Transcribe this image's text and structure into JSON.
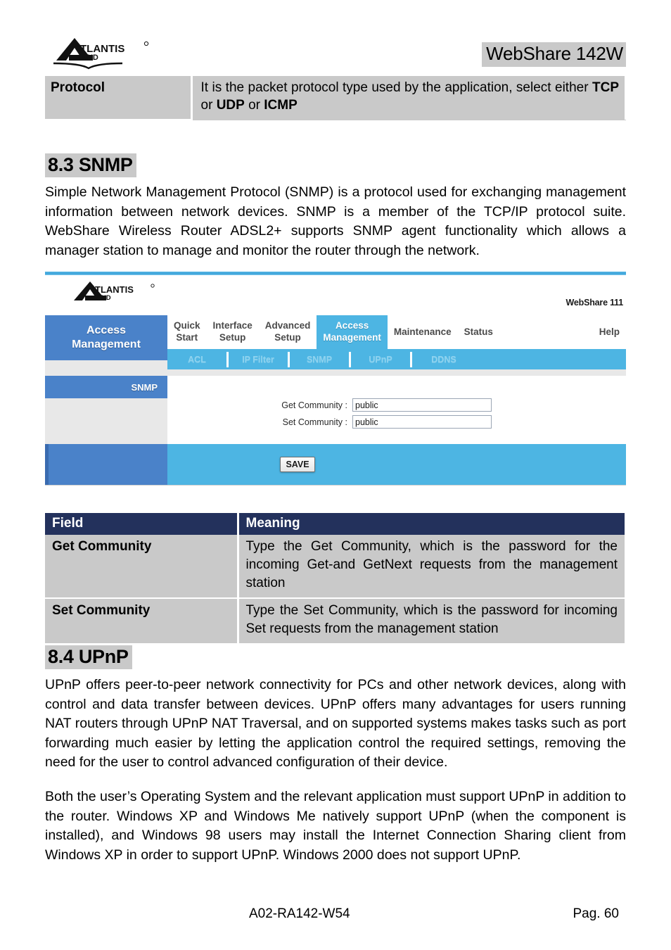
{
  "header": {
    "logo_alt": "ATLANTIS LAND",
    "logo_main": "TLANTIS",
    "logo_sub": "AND",
    "doc_title": "WebShare 142W"
  },
  "protocol_table": {
    "field": "Protocol",
    "meaning_prefix": "It is the packet protocol type used by the application, select either ",
    "meaning_tcp": "TCP",
    "meaning_or1": " or ",
    "meaning_udp": "UDP",
    "meaning_or2": " or ",
    "meaning_icmp": "ICMP"
  },
  "snmp_section": {
    "heading": "8.3 SNMP",
    "paragraph": "Simple Network Management Protocol (SNMP) is a protocol used for exchanging management information between network devices. SNMP is a member of the TCP/IP protocol suite. WebShare Wireless  Router ADSL2+ supports SNMP agent functionality which allows a manager station to manage and monitor the router through the network."
  },
  "router_ui": {
    "logo_main": "TLANTIS",
    "logo_sub": "AND",
    "model": "WebShare 111",
    "sidebar": {
      "title_line1": "Access",
      "title_line2": "Management",
      "current_page": "SNMP"
    },
    "nav": [
      {
        "line1": "Quick",
        "line2": "Start",
        "active": false
      },
      {
        "line1": "Interface",
        "line2": "Setup",
        "active": false
      },
      {
        "line1": "Advanced",
        "line2": "Setup",
        "active": false
      },
      {
        "line1": "Access",
        "line2": "Management",
        "active": true
      },
      {
        "line1": "Maintenance",
        "line2": "",
        "active": false
      },
      {
        "line1": "Status",
        "line2": "",
        "active": false
      },
      {
        "line1": "Help",
        "line2": "",
        "active": false
      }
    ],
    "subnav": [
      "ACL",
      "IP Filter",
      "SNMP",
      "UPnP",
      "DDNS"
    ],
    "form": {
      "get_community_label": "Get Community :",
      "get_community_value": "public",
      "set_community_label": "Set Community :",
      "set_community_value": "public"
    },
    "save_label": "SAVE",
    "colors": {
      "sidebar_blue": "#4a82c9",
      "accent_cyan": "#4db5e3",
      "panel_grey": "#e8e8e8"
    }
  },
  "field_table": {
    "headers": [
      "Field",
      "Meaning"
    ],
    "rows": [
      {
        "field": "Get Community",
        "meaning": "Type the Get Community, which is the password for the incoming Get-and GetNext requests from the management station"
      },
      {
        "field": "Set Community",
        "meaning": "Type the Set Community, which is the password for incoming Set requests from the management station"
      }
    ]
  },
  "upnp_section": {
    "heading": "8.4 UPnP",
    "paragraph1": "UPnP offers peer-to-peer network connectivity for PCs and other network devices, along with control and data transfer between devices. UPnP offers many advantages for users running NAT routers through UPnP NAT Traversal, and on supported systems makes tasks such as port forwarding much easier by letting the application control the required settings, removing the need for the user to control advanced configuration of their device.",
    "paragraph2": "Both the user’s Operating System and the relevant application must support UPnP in addition to the router. Windows XP and Windows Me natively support UPnP (when the component is installed), and Windows 98 users may install the Internet Connection Sharing client from Windows XP in order to support UPnP. Windows 2000 does not support UPnP."
  },
  "footer": {
    "doc_code": "A02-RA142-W54",
    "page_number": "Pag. 60"
  },
  "colors": {
    "table_header_navy": "#23315c",
    "table_body_grey": "#c9c9c9",
    "highlight_grey": "#c9c9c9"
  }
}
